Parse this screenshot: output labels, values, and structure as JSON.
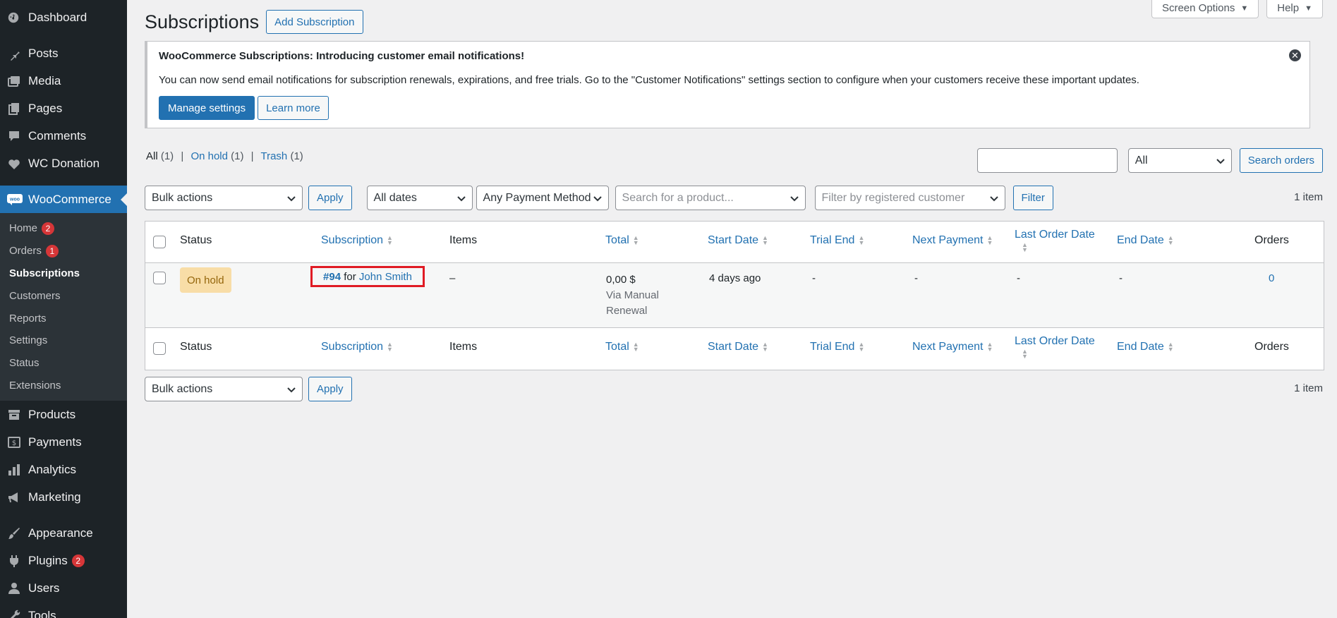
{
  "sidebar": {
    "top_items": [
      {
        "label": "Dashboard",
        "icon": "dashboard-icon"
      },
      {
        "label": "Posts",
        "icon": "pin-icon"
      },
      {
        "label": "Media",
        "icon": "media-icon"
      },
      {
        "label": "Pages",
        "icon": "pages-icon"
      },
      {
        "label": "Comments",
        "icon": "comment-icon"
      },
      {
        "label": "WC Donation",
        "icon": "heart-icon"
      }
    ],
    "woocommerce": {
      "label": "WooCommerce",
      "icon": "woo-icon"
    },
    "sub_items": [
      {
        "label": "Home",
        "badge": "2"
      },
      {
        "label": "Orders",
        "badge": "1"
      },
      {
        "label": "Subscriptions"
      },
      {
        "label": "Customers"
      },
      {
        "label": "Reports"
      },
      {
        "label": "Settings"
      },
      {
        "label": "Status"
      },
      {
        "label": "Extensions"
      }
    ],
    "bottom_items": [
      {
        "label": "Products",
        "icon": "archive-icon"
      },
      {
        "label": "Payments",
        "icon": "payments-icon"
      },
      {
        "label": "Analytics",
        "icon": "bar-chart-icon"
      },
      {
        "label": "Marketing",
        "icon": "megaphone-icon"
      },
      {
        "label": "Appearance",
        "icon": "brush-icon"
      },
      {
        "label": "Plugins",
        "icon": "plug-icon",
        "badge": "2"
      },
      {
        "label": "Users",
        "icon": "user-icon"
      },
      {
        "label": "Tools",
        "icon": "wrench-icon"
      }
    ]
  },
  "header": {
    "screen_options": "Screen Options",
    "help": "Help",
    "title": "Subscriptions",
    "add_button": "Add Subscription"
  },
  "notice": {
    "title": "WooCommerce Subscriptions: Introducing customer email notifications!",
    "text": "You can now send email notifications for subscription renewals, expirations, and free trials. Go to the \"Customer Notifications\" settings section to configure when your customers receive these important updates.",
    "primary_button": "Manage settings",
    "secondary_button": "Learn more"
  },
  "views": {
    "all": "All",
    "all_count": "(1)",
    "on_hold": "On hold",
    "on_hold_count": "(1)",
    "trash": "Trash",
    "trash_count": "(1)",
    "sep": "|"
  },
  "search": {
    "status_select": "All",
    "button": "Search orders"
  },
  "filters": {
    "bulk_actions": "Bulk actions",
    "apply": "Apply",
    "dates": "All dates",
    "payment_method": "Any Payment Method",
    "product_placeholder": "Search for a product...",
    "customer_placeholder": "Filter by registered customer",
    "filter_button": "Filter",
    "items_count": "1 item"
  },
  "table": {
    "columns": {
      "status": "Status",
      "subscription": "Subscription",
      "items": "Items",
      "total": "Total",
      "start_date": "Start Date",
      "trial_end": "Trial End",
      "next_payment": "Next Payment",
      "last_order_date": "Last Order Date",
      "end_date": "End Date",
      "orders": "Orders"
    },
    "row": {
      "status": "On hold",
      "sub_number": "#94",
      "sub_for": " for ",
      "sub_customer": "John Smith",
      "items": "–",
      "total": "0,00 $",
      "via": "Via Manual",
      "renewal": "Renewal",
      "start_date": "4 days ago",
      "trial_end": "-",
      "next_payment": "-",
      "last_order_date": "-",
      "end_date": "-",
      "orders": "0"
    }
  },
  "colors": {
    "sidebar_bg": "#1d2327",
    "accent": "#2271b1",
    "on_hold_bg": "#f8dda7",
    "on_hold_text": "#94660c",
    "highlight_border": "#e01b24",
    "badge": "#d63638"
  }
}
